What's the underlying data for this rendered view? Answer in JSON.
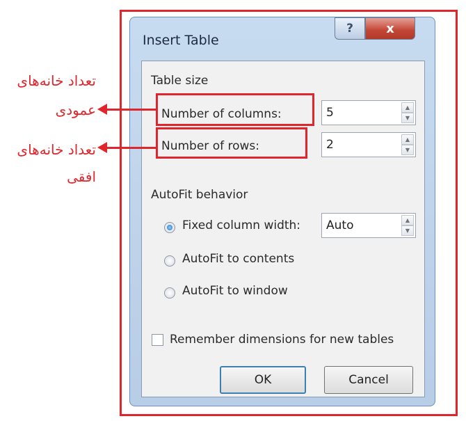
{
  "dialog": {
    "title": "Insert Table",
    "help_glyph": "?",
    "close_glyph": "x"
  },
  "table_size": {
    "heading": "Table size",
    "columns_label": "Number of columns:",
    "columns_value": "5",
    "rows_label": "Number of rows:",
    "rows_value": "2"
  },
  "autofit": {
    "heading": "AutoFit behavior",
    "fixed_label": "Fixed column width:",
    "fixed_value": "Auto",
    "contents_label": "AutoFit to contents",
    "window_label": "AutoFit to window",
    "selected": "fixed"
  },
  "remember_label": "Remember dimensions for new tables",
  "buttons": {
    "ok": "OK",
    "cancel": "Cancel"
  },
  "annotations": {
    "columns_line1": "تعداد خانه‌های",
    "columns_line2": "عمودی",
    "rows_line1": "تعداد خانه‌های",
    "rows_line2": "افقی",
    "color": "#e0262d"
  }
}
